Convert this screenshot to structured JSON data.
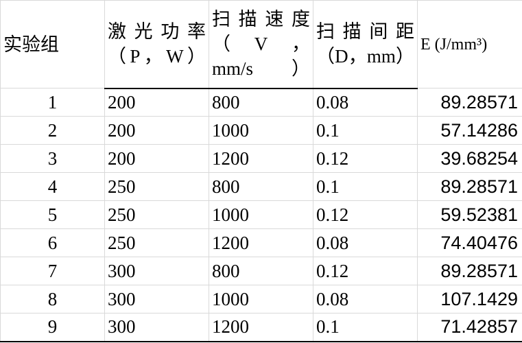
{
  "table": {
    "headers": [
      "实验组",
      "激光功率（P，W）",
      "扫描速度（V，mm/s）",
      "扫描间距（D，mm）",
      "E (J/mm³)"
    ],
    "rows": [
      [
        "1",
        "200",
        "800",
        "0.08",
        "89.28571"
      ],
      [
        "2",
        "200",
        "1000",
        "0.1",
        "57.14286"
      ],
      [
        "3",
        "200",
        "1200",
        "0.12",
        "39.68254"
      ],
      [
        "4",
        "250",
        "800",
        "0.1",
        "89.28571"
      ],
      [
        "5",
        "250",
        "1000",
        "0.12",
        "59.52381"
      ],
      [
        "6",
        "250",
        "1200",
        "0.08",
        "74.40476"
      ],
      [
        "7",
        "300",
        "800",
        "0.12",
        "89.28571"
      ],
      [
        "8",
        "300",
        "1000",
        "0.08",
        "107.1429"
      ],
      [
        "9",
        "300",
        "1200",
        "0.1",
        "71.42857"
      ]
    ]
  }
}
